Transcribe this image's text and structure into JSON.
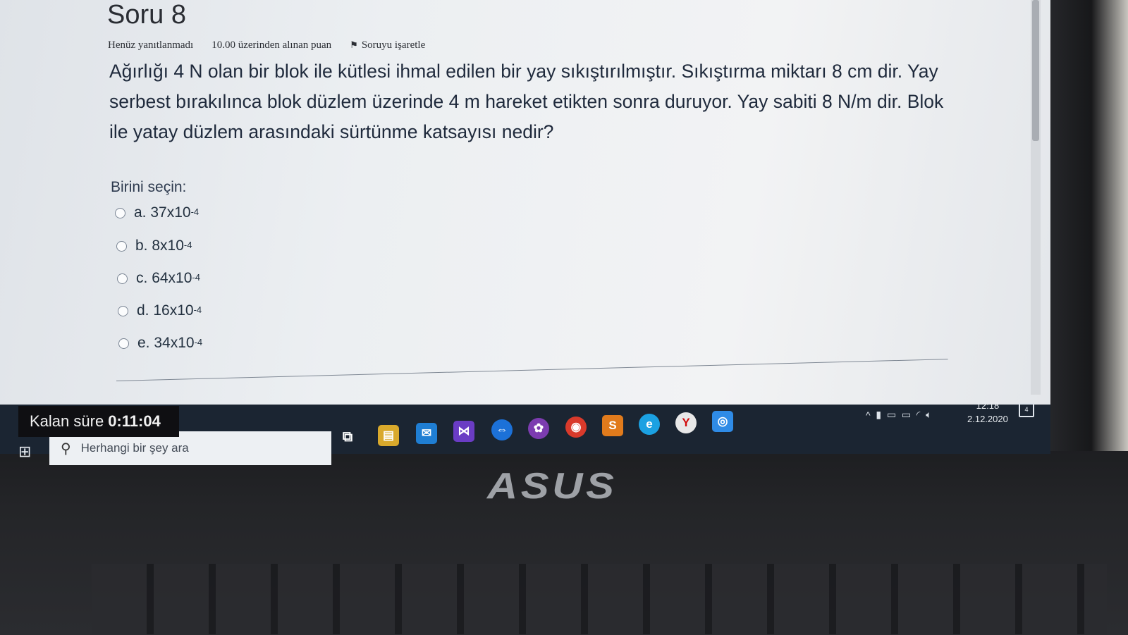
{
  "quiz": {
    "title": "Soru 8",
    "status": "Henüz yanıtlanmadı",
    "points": "10.00 üzerinden alınan puan",
    "flag_label": "Soruyu işaretle",
    "question": "Ağırlığı 4 N olan bir blok ile kütlesi ihmal edilen bir yay sıkıştırılmıştır. Sıkıştırma miktarı 8 cm dir. Yay serbest bırakılınca blok düzlem üzerinde 4 m hareket etikten sonra duruyor. Yay sabiti 8 N/m dir. Blok ile yatay düzlem arasındaki sürtünme katsayısı nedir?",
    "prompt": "Birini seçin:",
    "options": [
      {
        "letter": "a.",
        "base": "37x10",
        "exp": "-4"
      },
      {
        "letter": "b.",
        "base": "8x10",
        "exp": "-4"
      },
      {
        "letter": "c.",
        "base": "64x10",
        "exp": "-4"
      },
      {
        "letter": "d.",
        "base": "16x10",
        "exp": "-4"
      },
      {
        "letter": "e.",
        "base": "34x10",
        "exp": "-4"
      }
    ]
  },
  "timer": {
    "label": "Kalan süre",
    "value": "0:11:04"
  },
  "taskbar": {
    "search_placeholder": "Herhangi bir şey ara",
    "time": "12:18",
    "date": "2.12.2020",
    "notification_count": "4"
  },
  "brand": "ASUS"
}
